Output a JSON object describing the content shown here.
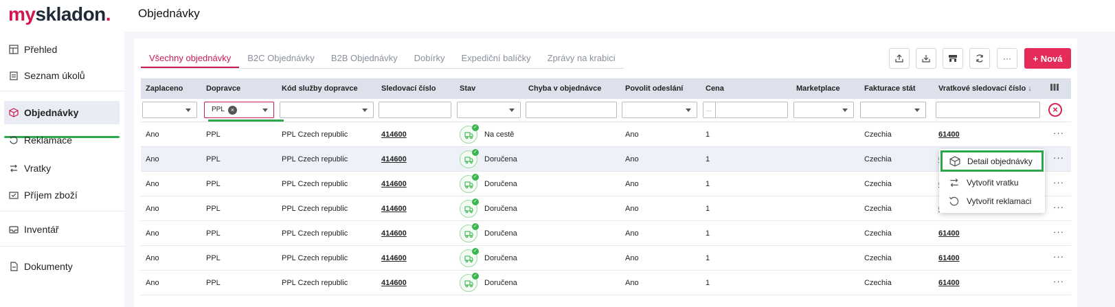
{
  "app": {
    "logo_part1": "my",
    "logo_part2": "skladon",
    "logo_dot": ".",
    "page_title": "Objednávky"
  },
  "sidebar": {
    "items": [
      {
        "label": "Přehled",
        "icon": "layout-icon"
      },
      {
        "label": "Seznam úkolů",
        "icon": "clipboard-icon"
      },
      {
        "label": "Objednávky",
        "icon": "box-icon",
        "active": true
      },
      {
        "label": "Reklamace",
        "icon": "return-circle-icon"
      },
      {
        "label": "Vratky",
        "icon": "swap-icon"
      },
      {
        "label": "Příjem zboží",
        "icon": "truck-in-icon"
      },
      {
        "label": "Inventář",
        "icon": "inbox-icon"
      },
      {
        "label": "Dokumenty",
        "icon": "document-icon"
      }
    ]
  },
  "tabs": [
    {
      "label": "Všechny objednávky",
      "active": true
    },
    {
      "label": "B2C Objednávky"
    },
    {
      "label": "B2B Objednávky"
    },
    {
      "label": "Dobírky"
    },
    {
      "label": "Expediční balíčky"
    },
    {
      "label": "Zprávy na krabici"
    }
  ],
  "toolbar": {
    "more_label": "···",
    "new_label": "+ Nová"
  },
  "columns": [
    "Zaplaceno",
    "Dopravce",
    "Kód služby dopravce",
    "Sledovací číslo",
    "Stav",
    "Chyba v objednávce",
    "Povolit odeslání",
    "Cena",
    "Marketplace",
    "Fakturace stát",
    "Vratkové sledovací číslo"
  ],
  "sort_indicator": "↓",
  "filters": {
    "carrier_chip": "PPL",
    "chip_remove": "×",
    "price_prefix": "...",
    "clear_icon": "×"
  },
  "rows": [
    {
      "paid": "Ano",
      "carrier": "PPL",
      "service": "PPL Czech republic",
      "tracking": "414600",
      "status": "Na cestě",
      "status_icon": "truck-icon",
      "allow": "Ano",
      "price": "1",
      "country": "Czechia",
      "return_tracking": "61400"
    },
    {
      "paid": "Ano",
      "carrier": "PPL",
      "service": "PPL Czech republic",
      "tracking": "414600",
      "status": "Doručena",
      "status_icon": "delivered-icon",
      "allow": "Ano",
      "price": "1",
      "country": "Czechia",
      "return_tracking": "6"
    },
    {
      "paid": "Ano",
      "carrier": "PPL",
      "service": "PPL Czech republic",
      "tracking": "414600",
      "status": "Doručena",
      "status_icon": "delivered-icon",
      "allow": "Ano",
      "price": "1",
      "country": "Czechia",
      "return_tracking": "6"
    },
    {
      "paid": "Ano",
      "carrier": "PPL",
      "service": "PPL Czech republic",
      "tracking": "414600",
      "status": "Doručena",
      "status_icon": "delivered-icon",
      "allow": "Ano",
      "price": "1",
      "country": "Czechia",
      "return_tracking": "6"
    },
    {
      "paid": "Ano",
      "carrier": "PPL",
      "service": "PPL Czech republic",
      "tracking": "414600",
      "status": "Doručena",
      "status_icon": "delivered-icon",
      "allow": "Ano",
      "price": "1",
      "country": "Czechia",
      "return_tracking": "61400"
    },
    {
      "paid": "Ano",
      "carrier": "PPL",
      "service": "PPL Czech republic",
      "tracking": "414600",
      "status": "Doručena",
      "status_icon": "delivered-icon",
      "allow": "Ano",
      "price": "1",
      "country": "Czechia",
      "return_tracking": "61400"
    },
    {
      "paid": "Ano",
      "carrier": "PPL",
      "service": "PPL Czech republic",
      "tracking": "414600",
      "status": "Doručena",
      "status_icon": "delivered-icon",
      "allow": "Ano",
      "price": "1",
      "country": "Czechia",
      "return_tracking": "61400"
    }
  ],
  "row_menu_label": "···",
  "context_menu": {
    "items": [
      {
        "label": "Detail objednávky",
        "icon": "box-icon"
      },
      {
        "label": "Vytvořit vratku",
        "icon": "swap-icon"
      },
      {
        "label": "Vytvořit reklamaci",
        "icon": "return-circle-icon"
      }
    ]
  },
  "colors": {
    "brand": "#d0174e",
    "accent_button": "#e52b5a",
    "highlight_green": "#2aa84a"
  }
}
